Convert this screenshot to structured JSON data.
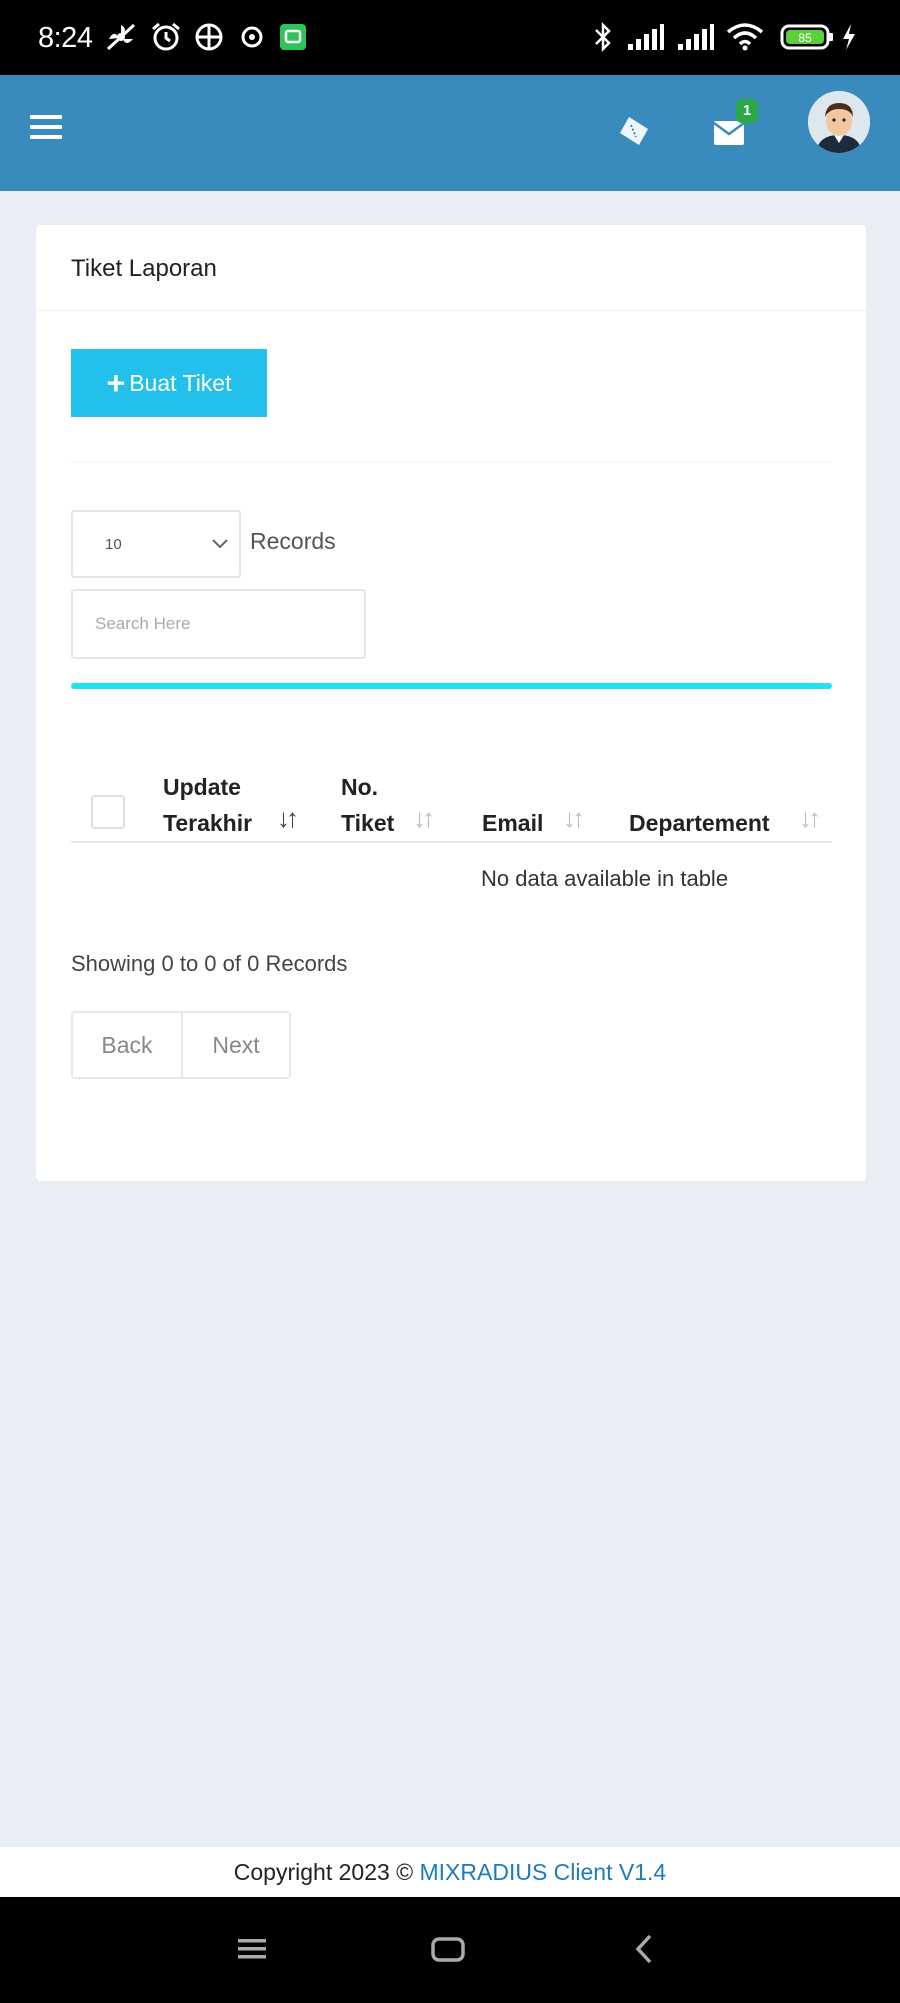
{
  "status_bar": {
    "time": "8:24",
    "battery": "85"
  },
  "header": {
    "notification_count": "1",
    "icons": [
      "menu-icon",
      "ticket-icon",
      "mail-icon",
      "avatar"
    ]
  },
  "card": {
    "title": "Tiket Laporan",
    "create_button": "Buat Tiket",
    "records_select_value": "10",
    "records_label": "Records",
    "search_placeholder": "Search Here",
    "table": {
      "columns": [
        {
          "line1": "Update",
          "line2": "Terakhir"
        },
        {
          "line1": "No.",
          "line2": "Tiket"
        },
        {
          "line1": "",
          "line2": "Email"
        },
        {
          "line1": "",
          "line2": "Departement"
        }
      ],
      "empty_text": "No data available in table"
    },
    "showing_text": "Showing 0 to 0 of 0 Records",
    "pager": {
      "back": "Back",
      "next": "Next"
    }
  },
  "footer": {
    "prefix": "Copyright 2023 © ",
    "brand": "MIXRADIUS Client V1.4"
  },
  "colors": {
    "header": "#3a8bbd",
    "accent_button": "#22c0ea",
    "progress_line": "#1ee3f0",
    "badge": "#2aa846",
    "brand_link": "#1e7bbf"
  }
}
